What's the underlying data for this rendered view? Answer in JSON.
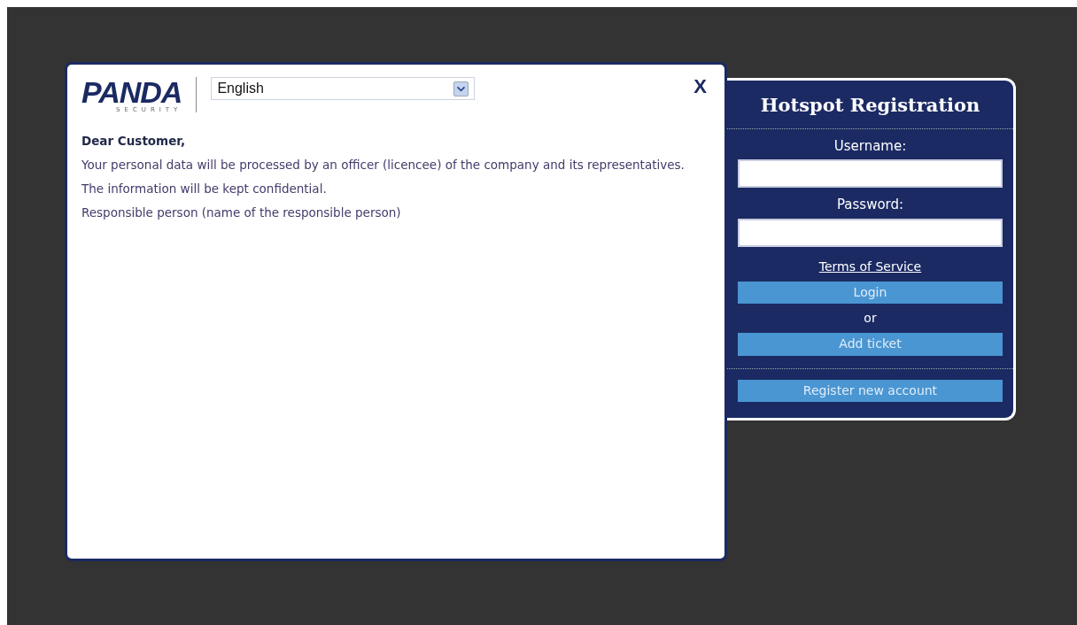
{
  "logo": {
    "name": "PANDA",
    "tagline": "SECURITY"
  },
  "language_select": {
    "value": "English"
  },
  "close": "X",
  "message": {
    "greeting": "Dear Customer,",
    "paragraphs": [
      "Your personal data will be processed by an officer (licencee) of the company and its representatives.",
      "The information will be kept confidential.",
      "Responsible person (name of the responsible person)"
    ]
  },
  "registration": {
    "title": "Hotspot Registration",
    "username_label": "Username:",
    "password_label": "Password:",
    "terms_link": "Terms of Service",
    "login_button": "Login",
    "or": "or",
    "ticket_button": "Add ticket",
    "register_button": "Register new account"
  }
}
